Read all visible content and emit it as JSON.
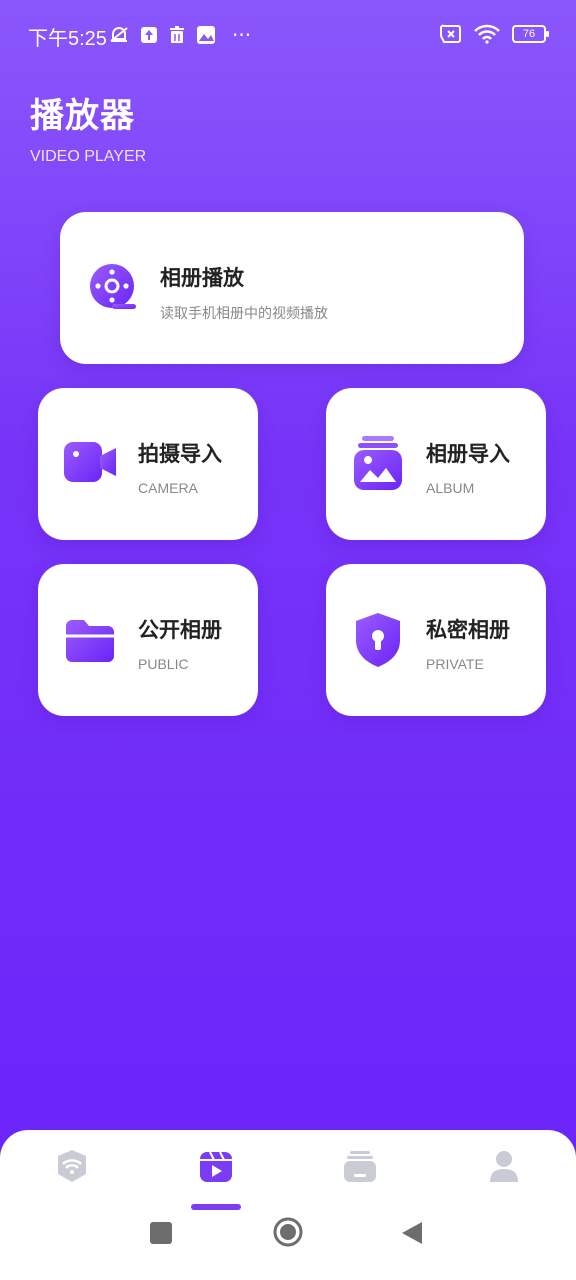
{
  "status": {
    "time": "下午5:25",
    "battery": "76"
  },
  "header": {
    "title": "播放器",
    "subtitle": "VIDEO PLAYER"
  },
  "cards": {
    "album_play": {
      "title": "相册播放",
      "subtitle": "读取手机相册中的视频播放",
      "icon": "film-reel-icon"
    },
    "camera_import": {
      "title": "拍摄导入",
      "subtitle": "CAMERA",
      "icon": "video-camera-icon"
    },
    "album_import": {
      "title": "相册导入",
      "subtitle": "ALBUM",
      "icon": "photo-album-icon"
    },
    "public_album": {
      "title": "公开相册",
      "subtitle": "PUBLIC",
      "icon": "folder-icon"
    },
    "private_album": {
      "title": "私密相册",
      "subtitle": "PRIVATE",
      "icon": "shield-lock-icon"
    }
  },
  "bottom_nav": {
    "items": [
      "wifi-icon",
      "video-clapper-icon",
      "stack-icon",
      "user-icon"
    ],
    "active_index": 1
  },
  "colors": {
    "accent": "#7b3cf6",
    "gradient_top": "#8a57fb",
    "gradient_bottom": "#6a22fa"
  }
}
